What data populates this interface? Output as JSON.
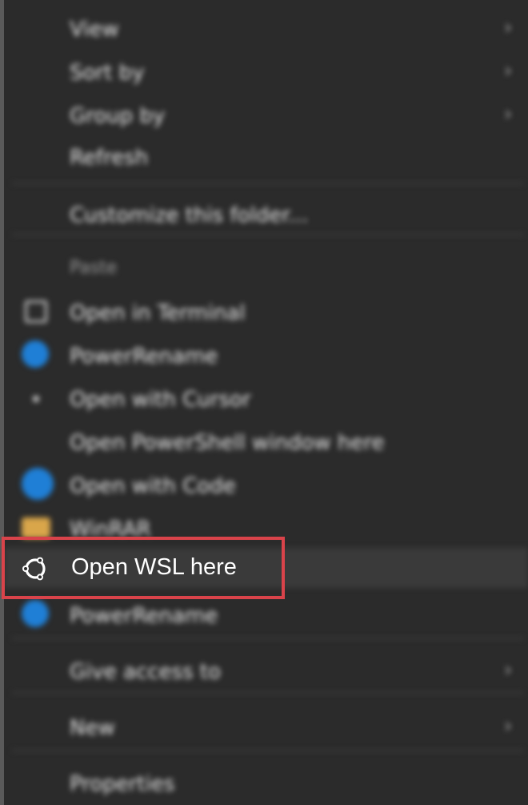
{
  "menu": {
    "items": [
      {
        "label": "View",
        "submenu": true
      },
      {
        "label": "Sort by",
        "submenu": true
      },
      {
        "label": "Group by",
        "submenu": true
      },
      {
        "label": "Refresh",
        "submenu": false
      },
      {
        "label": "Customize this folder...",
        "submenu": false
      },
      {
        "label": "Paste",
        "submenu": false,
        "disabled": true
      },
      {
        "label": "Open in Terminal",
        "icon": "terminal-icon"
      },
      {
        "label": "PowerRename",
        "icon": "powerrename-icon"
      },
      {
        "label": "Open with Cursor",
        "icon": "cursor-icon"
      },
      {
        "label": "Open PowerShell window here",
        "icon": ""
      },
      {
        "label": "Open with Code",
        "icon": "vscode-icon"
      },
      {
        "label": "WinRAR",
        "icon": "winrar-icon"
      },
      {
        "label": "Open WSL here",
        "icon": "ubuntu-icon"
      },
      {
        "label": "PowerRename",
        "icon": "powerrename-icon"
      },
      {
        "label": "Give access to",
        "submenu": true
      },
      {
        "label": "New",
        "submenu": true
      },
      {
        "label": "Properties",
        "submenu": false
      }
    ],
    "focused_label": "Open WSL here",
    "chevron": "›"
  },
  "colors": {
    "background": "#2b2b2b",
    "highlight_border": "#d9434a",
    "text": "#ffffff"
  }
}
